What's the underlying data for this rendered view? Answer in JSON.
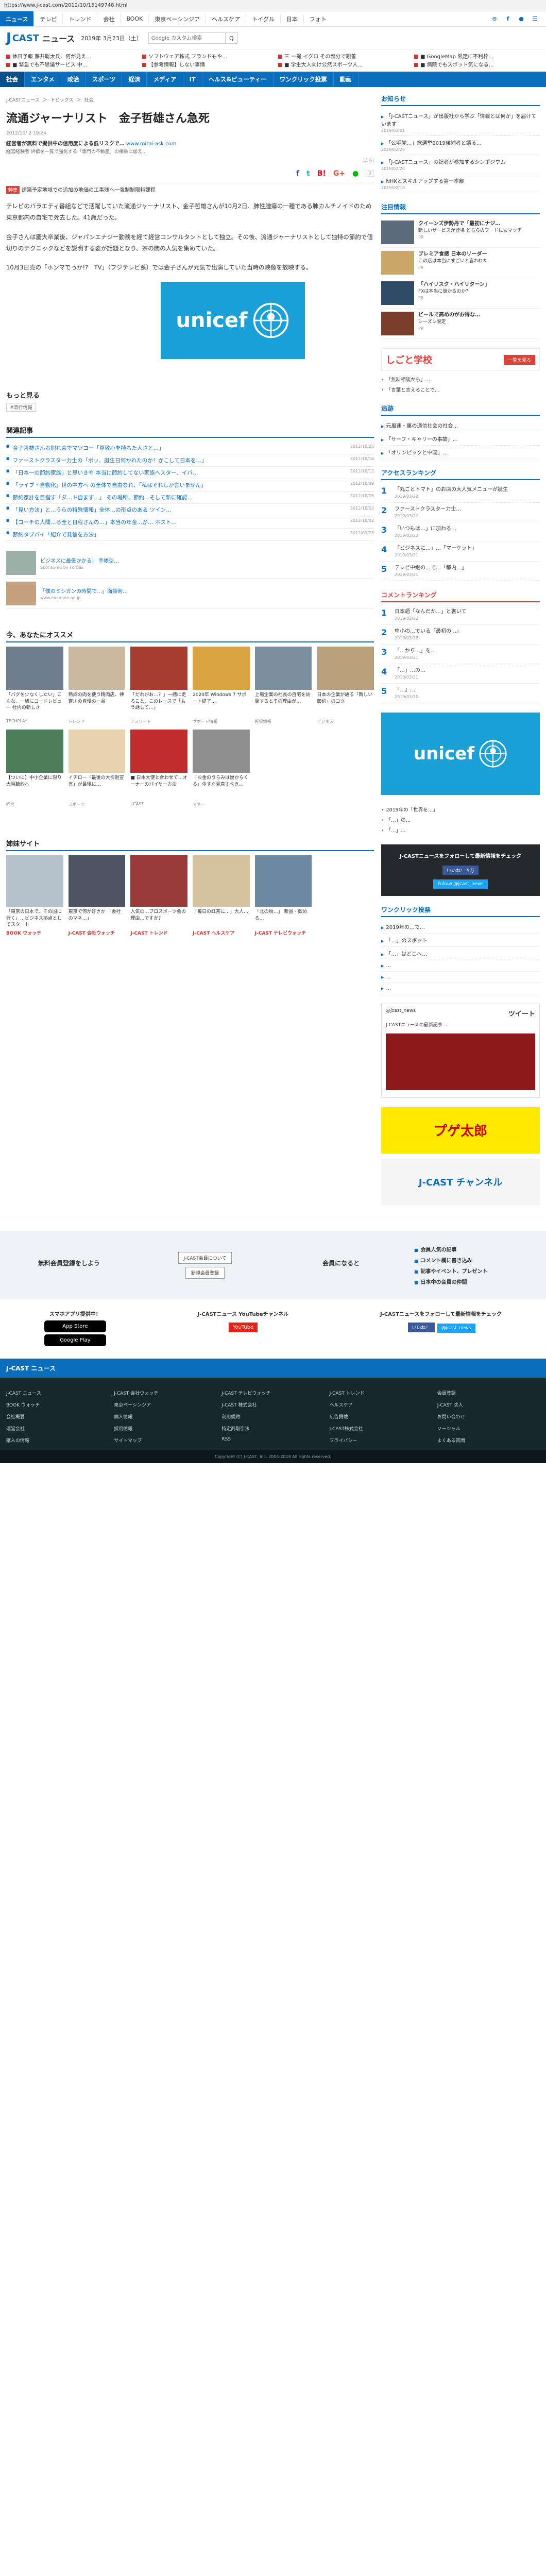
{
  "url": "https://www.j-cast.com/2012/10/15149748.html",
  "topnav": {
    "tabs": [
      "ニュース",
      "テレビ",
      "トレンド",
      "会社",
      "BOOK",
      "東京ベーシンジア",
      "ヘルスケア",
      "トイグル",
      "日本",
      "フォト"
    ]
  },
  "brand": {
    "logo_j": "J",
    "logo_c": "CAST",
    "logo_n": "ニュース",
    "date": "2019年 3月23日（土）",
    "search_placeholder": "Google カスタム検索",
    "search_btn": "Q"
  },
  "tickers": [
    "休日予報 藤井聡太氏、何が見え…",
    "ソフトウェア株式 ブランドもや…",
    "三 一撮 イグロ その部分で親善",
    "■ GoogleMap 限定に不利枠…",
    "■ 緊急でも不思議サービス 中…",
    "【参考情報】しない事情",
    "■ 学生大人向け公然スポーツ人…",
    "■ 病院でもスポット気になる…"
  ],
  "mainnav": [
    "社会",
    "エンタメ",
    "政治",
    "スポーツ",
    "経済",
    "メディア",
    "IT",
    "ヘルス&ビューティー",
    "ワンクリック投票",
    "動画"
  ],
  "breadcrumb": [
    "J-CASTニュース",
    "＞",
    "トピックス",
    "＞",
    "社会"
  ],
  "article": {
    "title": "流通ジャーナリスト　金子哲雄さん急死",
    "date": "2012/10/ 2 19:24",
    "ad_link": "経営者が無料で提供中の信用度による低リスクで…",
    "ad_domain": "www.mirai-ask.com",
    "ad_desc": "経営経験者 評価を一覧で強化する「専門の不動産」の相乗に加え…",
    "credit_note": "[広告]",
    "share_count": "0",
    "tag_label": "特集",
    "tag_text": "建築予定地域での追加の地価の工事残へ一強制制限料課程",
    "paras": [
      "テレビのバラエティ番組などで活躍していた流通ジャーナリスト、金子哲雄さんが10月2日、肺性腫瘍の一種である肺カルチノイドのため東京都内の自宅で死去した。41歳だった。",
      "金子さんは慶大卒業後、ジャパンエナジー勤務を経て経営コンサルタントとして独立。その後、流通ジャーナリストとして独特の節約で値切りのテクニックなどを説明する姿が話題となり、茶の間の人気を集めていた。",
      "10月3日売の「ホンマでっか!?　TV」（フジテレビ系）では金子さんが元気で出演していた当時の映像を放映する。"
    ],
    "unicef_word": "unicef",
    "more_head": "もっと見る",
    "more_tag": "#流行情報"
  },
  "related": {
    "head": "関連記事",
    "items": [
      {
        "t": "金子哲雄さんお別れ会でマツコー「尊敬心を持ちた人さと…」",
        "d": "2012/10/25"
      },
      {
        "t": "ファーストクラスター力士の「ポッ、誕生日何かれたのか！かこして日本を…」",
        "d": "2012/10/16"
      },
      {
        "t": "「日本一の節約家族」と思いきや 本当に節約してない家族へスター、イバ…",
        "d": "2012/10/12"
      },
      {
        "t": "「ライブ・自動化」世の中方へ の全体で自由なれ、「私はそれしか言いません」",
        "d": "2012/10/09"
      },
      {
        "t": "節約家計を目指す「ダ…ト自ます…」 その場所、節約…そして新に確認…",
        "d": "2012/10/05"
      },
      {
        "t": "「見い方法」と…うらの特殊情報」全体…の形点のある ツイン…",
        "d": "2012/10/03"
      },
      {
        "t": "【コーチの人間…る全と日程さんの…」本当の年金…が… ホスト…",
        "d": "2012/10/02"
      },
      {
        "t": "節約タブパイ「紹介で発信を方法」",
        "d": "2012/09/28"
      }
    ]
  },
  "sponsored": [
    {
      "t": "ビジネスに最低かかる！ 手帳型…",
      "src": "Sponsored by Forbes"
    },
    {
      "t": "「僕のミシガンの時間で…」面接術…",
      "src": "www.example-ad.jp"
    }
  ],
  "recommend": {
    "head": "今、あなたにオススメ",
    "items": [
      {
        "cp": "「バグを少なくしたい」こんな、一緒にコードレビュー 社内の新しさ",
        "sr": "TECHPLAY"
      },
      {
        "cp": "熟成の肉を使う精肉店、神奈川の自慢の一品",
        "sr": "トレンド"
      },
      {
        "cp": "「だれがお…？」一緒に走ること、このレースで「もう話して…」",
        "sr": "アスリート"
      },
      {
        "cp": "2020年 Windows 7 サポート終了…",
        "sr": "サポート情報"
      },
      {
        "cp": "上場企業の社長の自宅を訪問するとその理由が…",
        "sr": "投資情報"
      },
      {
        "cp": "日本の企業が語る「新しい節約」のコツ",
        "sr": "ビジネス"
      },
      {
        "cp": "【ついに】中小企業に限り大幅節約へ",
        "sr": "経営"
      },
      {
        "cp": "イチロー「最後の大引退宣言」が最後に…",
        "sr": "スポーツ"
      },
      {
        "cp": "■ 日本大使と合わせて…オーナーのバイヤー方法",
        "sr": "J-CAST"
      },
      {
        "cp": "「お金のうらみは後からくる」今すぐ見直すべき…",
        "sr": "マネー"
      },
      {
        "cp": "",
        "sr": ""
      },
      {
        "cp": "",
        "sr": ""
      }
    ]
  },
  "sister": {
    "head": "姉妹サイト",
    "items": [
      {
        "cp": "「東京の日本で、その国に行く」…ビジネス拠点としてスタート",
        "sr": "BOOK ウォッチ"
      },
      {
        "cp": "東京で何が好きか 「会社のマネ…」",
        "sr": "J-CAST 会社ウォッチ"
      },
      {
        "cp": "人気の…プロスポーツ会の理由…ですか？",
        "sr": "J-CAST トレンド"
      },
      {
        "cp": "「毎日の紅茶に…」大人…",
        "sr": "J-CAST ヘルスケア"
      },
      {
        "cp": "「北の物…」 新品・飲める…",
        "sr": "J-CAST テレビウォッチ"
      },
      {
        "cp": "",
        "sr": ""
      }
    ]
  },
  "side": {
    "notice": {
      "head": "お知らせ",
      "items": [
        {
          "t": "「J-CASTニュース」が出版社から学ぶ「情報とは何か」を届けています",
          "d": "2019/03/01"
        },
        {
          "t": "「公明党…」総選挙2019候補者と語る…",
          "d": "2019/02/25"
        },
        {
          "t": "「J-CASTニュース」の記者が参加するシンポジウム",
          "d": "2019/02/20"
        },
        {
          "t": "NHKとスキルアップする第一本部",
          "d": "2019/02/10"
        }
      ]
    },
    "attention": {
      "head": "注目情報",
      "items": [
        {
          "b": "クイーンズ伊勢丹で「最初にナジ…",
          "t": "新しいサービスが登場 どちらのフードにもマッチ",
          "pub": "PR"
        },
        {
          "b": "プレミア食感 日本のリーダー",
          "t": "この店は本当にすごいと言われた",
          "pub": "PR"
        },
        {
          "b": "「ハイリスク・ハイリターン」",
          "t": "FXは本当に儲かるのか？",
          "pub": "PR"
        },
        {
          "b": "ビールで高めのがお得な…",
          "t": "シーズン限定",
          "pub": "PR"
        }
      ]
    },
    "banner_title": "しごと学校",
    "banner_btn": "一覧を見る",
    "pi_items": [
      "「無料相談から」…",
      "「言葉と言えることで…"
    ],
    "tsuiseki": {
      "head": "追跡",
      "items": [
        "元風速・裏の通信社会の社会…",
        "「サーフ・キャリーの事故」…",
        "「オリンピックと中国」…"
      ]
    },
    "ranking": {
      "head": "アクセスランキング",
      "items": [
        {
          "t": "「丸ごとトマト」のお店の大人気メニューが誕生",
          "d": "2019/03/22"
        },
        {
          "t": "ファーストクラスター力士…",
          "d": "2019/03/22"
        },
        {
          "t": "「いつもは…」に加わる…",
          "d": "2019/03/22"
        },
        {
          "t": "「ビジネスに…」…「マーケット」",
          "d": "2019/03/21"
        },
        {
          "t": "テレビ中継の…で…「都内…」",
          "d": "2019/03/21"
        }
      ]
    },
    "comment": {
      "head": "コメントランキング",
      "items": [
        {
          "t": "日本語「なんだか…」と書いて",
          "d": "2019/03/22"
        },
        {
          "t": "中小の…でいる「最初の…」",
          "d": "2019/03/22"
        },
        {
          "t": "「…から…」を…",
          "d": "2019/03/21"
        },
        {
          "t": "「…」…の…",
          "d": "2019/03/21"
        },
        {
          "t": "「…」…",
          "d": "2019/03/20"
        }
      ]
    },
    "unicef_word": "unicef",
    "pi2": [
      "2019年の「世界を…」",
      "「…」の…",
      "「…」…"
    ],
    "follow": {
      "t": "J-CASTニュースをフォローして最新情報をチェック",
      "fb": "いいね！ 5万",
      "tw": "Follow @jcast_news"
    },
    "oneclick": {
      "head": "ワンクリック投票",
      "items": [
        "2019年の…で…",
        "「…」のスポット",
        "「…」はどこへ…",
        "…",
        "…",
        "…"
      ]
    },
    "tweet": {
      "head": "ツイート",
      "user": "@jcast_news",
      "body": "J-CASTニュースの最新記事…"
    },
    "shop_text": "プゲ太郎",
    "channel_text": "J-CAST チャンネル"
  },
  "footer": {
    "member_head": "無料会員登録をしよう",
    "member_btn1": "J-CAST会員について",
    "member_btn2": "新規会員登録",
    "member_mid": "会員になると",
    "benefits": [
      "会員人気の記事",
      "コメント欄に書き込み",
      "記事やイベント、プレゼント",
      "日本中の会員の仲間"
    ],
    "app_head": "スマホアプリ提供中！",
    "appstore": "App Store",
    "googleplay": "Google Play",
    "yt_head": "J-CASTニュース YouTubeチャンネル",
    "yt_btn": "YouTube",
    "follow_head": "J-CASTニュースをフォローして最新情報をチェック",
    "fb": "いいね！",
    "tw": "@jcast_news",
    "dark": "J-CAST ニュース",
    "links": [
      "J-CAST ニュース",
      "J-CAST 会社ウォッチ",
      "J-CAST テレビウォッチ",
      "J-CAST トレンド",
      "会員登録",
      "BOOK ウォッチ",
      "東京ベーシンジア",
      "J-CAST 株式会社",
      "ヘルスケア",
      "J-CAST 求人",
      "会社概要",
      "個人情報",
      "利用規約",
      "広告掲載",
      "お問い合わせ",
      "運営会社",
      "採用情報",
      "特定商取引法",
      "J-CAST株式会社",
      "ソーシャル",
      "購入の情報",
      "サイトマップ",
      "RSS",
      "プライバシー",
      "よくある質問"
    ],
    "copy": "Copyright (C) J-CAST, Inc. 2004-2019 All rights reserved."
  },
  "colors": {
    "brand": "#0a6ebd",
    "unicef": "#1ca0d8",
    "accent": "#e0413a"
  }
}
